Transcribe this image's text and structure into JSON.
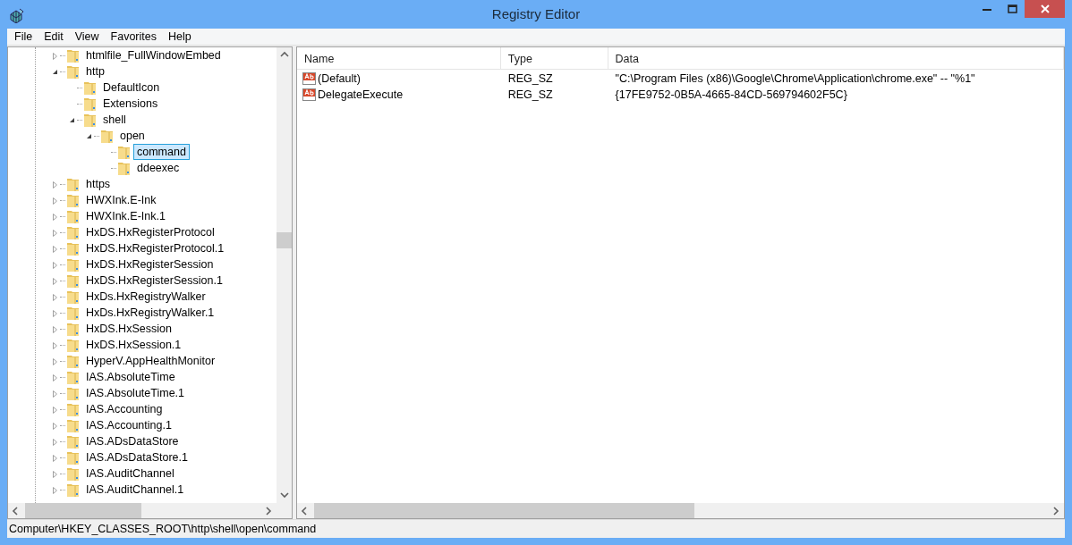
{
  "window": {
    "title": "Registry Editor"
  },
  "menu": [
    "File",
    "Edit",
    "View",
    "Favorites",
    "Help"
  ],
  "tree": [
    {
      "label": "htmlfile_FullWindowEmbed",
      "selected": false,
      "expanded": false
    },
    {
      "label": "http",
      "selected": false,
      "expanded": true,
      "children": [
        {
          "label": "DefaultIcon",
          "selected": false
        },
        {
          "label": "Extensions",
          "selected": false
        },
        {
          "label": "shell",
          "selected": false,
          "expanded": true,
          "children": [
            {
              "label": "open",
              "selected": false,
              "expanded": true,
              "children": [
                {
                  "label": "command",
                  "selected": true
                },
                {
                  "label": "ddeexec",
                  "selected": false
                }
              ]
            }
          ]
        }
      ]
    },
    {
      "label": "https",
      "selected": false,
      "expanded": false
    },
    {
      "label": "HWXInk.E-Ink",
      "selected": false,
      "expanded": false
    },
    {
      "label": "HWXInk.E-Ink.1",
      "selected": false,
      "expanded": false
    },
    {
      "label": "HxDS.HxRegisterProtocol",
      "selected": false,
      "expanded": false
    },
    {
      "label": "HxDS.HxRegisterProtocol.1",
      "selected": false,
      "expanded": false
    },
    {
      "label": "HxDS.HxRegisterSession",
      "selected": false,
      "expanded": false
    },
    {
      "label": "HxDS.HxRegisterSession.1",
      "selected": false,
      "expanded": false
    },
    {
      "label": "HxDs.HxRegistryWalker",
      "selected": false,
      "expanded": false
    },
    {
      "label": "HxDs.HxRegistryWalker.1",
      "selected": false,
      "expanded": false
    },
    {
      "label": "HxDS.HxSession",
      "selected": false,
      "expanded": false
    },
    {
      "label": "HxDS.HxSession.1",
      "selected": false,
      "expanded": false
    },
    {
      "label": "HyperV.AppHealthMonitor",
      "selected": false,
      "expanded": false
    },
    {
      "label": "IAS.AbsoluteTime",
      "selected": false,
      "expanded": false
    },
    {
      "label": "IAS.AbsoluteTime.1",
      "selected": false,
      "expanded": false
    },
    {
      "label": "IAS.Accounting",
      "selected": false,
      "expanded": false
    },
    {
      "label": "IAS.Accounting.1",
      "selected": false,
      "expanded": false
    },
    {
      "label": "IAS.ADsDataStore",
      "selected": false,
      "expanded": false
    },
    {
      "label": "IAS.ADsDataStore.1",
      "selected": false,
      "expanded": false
    },
    {
      "label": "IAS.AuditChannel",
      "selected": false,
      "expanded": false
    },
    {
      "label": "IAS.AuditChannel.1",
      "selected": false,
      "expanded": false
    }
  ],
  "values": {
    "columns": [
      "Name",
      "Type",
      "Data"
    ],
    "rows": [
      {
        "name": "(Default)",
        "type": "REG_SZ",
        "data": "\"C:\\Program Files (x86)\\Google\\Chrome\\Application\\chrome.exe\" -- \"%1\""
      },
      {
        "name": "DelegateExecute",
        "type": "REG_SZ",
        "data": "{17FE9752-0B5A-4665-84CD-569794602F5C}"
      }
    ]
  },
  "status_bar": "Computer\\HKEY_CLASSES_ROOT\\http\\shell\\open\\command"
}
